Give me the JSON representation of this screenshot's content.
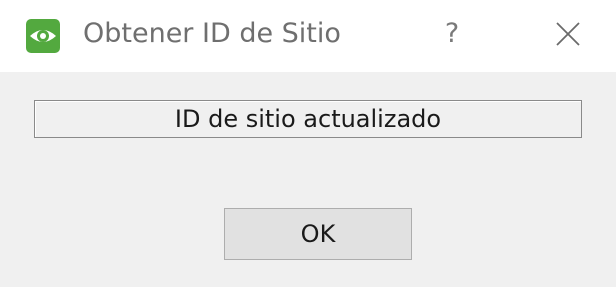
{
  "window": {
    "title": "Obtener ID de Sitio",
    "help_label": "?",
    "app_icon": "eye-icon",
    "close_icon": "close-icon"
  },
  "content": {
    "status_message": "ID de sitio actualizado"
  },
  "buttons": {
    "ok_label": "OK"
  },
  "colors": {
    "icon_background": "#53a93f",
    "titlebar_background": "#ffffff",
    "dialog_background": "#f0f0f0",
    "button_background": "#e1e1e1"
  }
}
